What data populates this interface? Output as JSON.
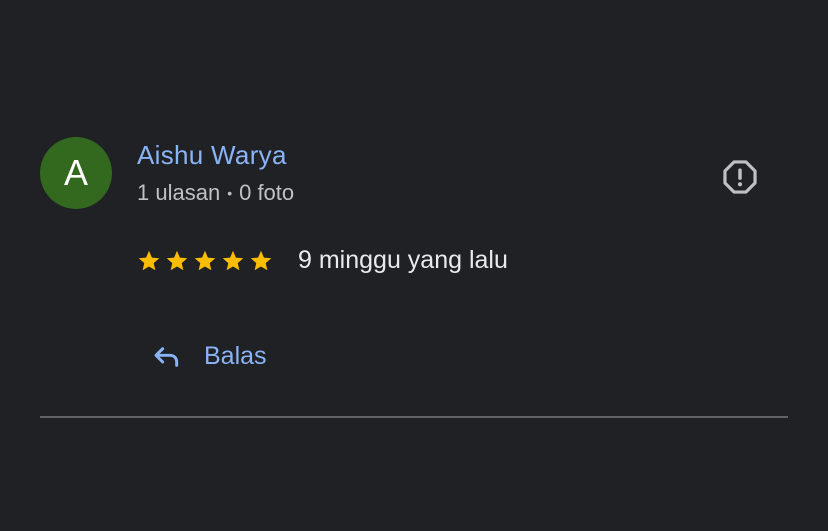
{
  "review": {
    "avatar_letter": "A",
    "author_name": "Aishu Warya",
    "reviews_count": "1 ulasan",
    "meta_separator": "•",
    "photos_count": "0 foto",
    "rating": 5,
    "rating_max": 5,
    "time_ago": "9 minggu yang lalu",
    "reply_label": "Balas",
    "report_icon": "report-octagon-icon",
    "reply_icon": "reply-arrow-icon"
  },
  "colors": {
    "background": "#202124",
    "avatar_bg": "#33691e",
    "link": "#8ab4f8",
    "star": "#fbbc04",
    "secondary_text": "#bdc1c6",
    "divider": "#5f6368"
  }
}
